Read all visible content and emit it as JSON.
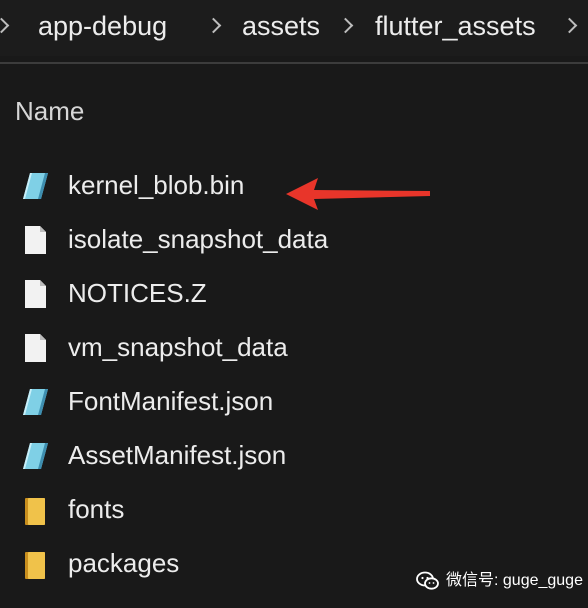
{
  "breadcrumb": {
    "items": [
      {
        "label": "app-debug"
      },
      {
        "label": "assets"
      },
      {
        "label": "flutter_assets"
      }
    ]
  },
  "list": {
    "column_name": "Name",
    "items": [
      {
        "name": "kernel_blob.bin",
        "icon": "blue-file-icon"
      },
      {
        "name": "isolate_snapshot_data",
        "icon": "generic-file-icon"
      },
      {
        "name": "NOTICES.Z",
        "icon": "generic-file-icon"
      },
      {
        "name": "vm_snapshot_data",
        "icon": "generic-file-icon"
      },
      {
        "name": "FontManifest.json",
        "icon": "blue-file-icon"
      },
      {
        "name": "AssetManifest.json",
        "icon": "blue-file-icon"
      },
      {
        "name": "fonts",
        "icon": "folder-icon"
      },
      {
        "name": "packages",
        "icon": "folder-icon"
      }
    ]
  },
  "annotation": {
    "arrow_color": "#e8352a",
    "points_to": "kernel_blob.bin"
  },
  "watermark": {
    "text": "微信号: guge_guge",
    "icon": "wechat-icon"
  },
  "colors": {
    "background": "#191919",
    "text": "#ececec",
    "folder": "#e8b838",
    "blue_file": "#6ec3dc"
  }
}
